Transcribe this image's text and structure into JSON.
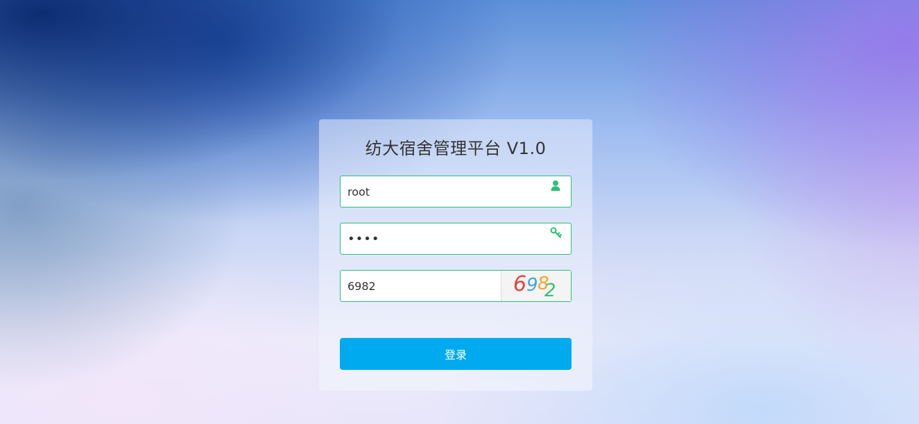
{
  "title": "纺大宿舍管理平台 V1.0",
  "form": {
    "username": {
      "value": "root"
    },
    "password": {
      "value": "••••"
    },
    "captcha": {
      "value": "6982",
      "image_chars": [
        {
          "char": "6",
          "color": "#e8413c"
        },
        {
          "char": "9",
          "color": "#3aa7e0"
        },
        {
          "char": "8",
          "color": "#f5a623"
        },
        {
          "char": "2",
          "color": "#34c27a"
        }
      ]
    },
    "login_label": "登录"
  },
  "colors": {
    "accent": "#00aaee",
    "field_border": "#2bbf78",
    "icon": "#2bbf78"
  },
  "icons": {
    "username": "user-icon",
    "password": "key-icon"
  }
}
